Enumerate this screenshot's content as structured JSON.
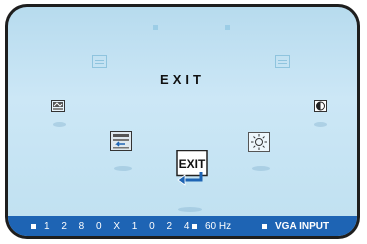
{
  "osd": {
    "menu_title": "EXIT",
    "selected_icon": "exit-icon",
    "icons": [
      "picture-icon-faint",
      "color-icon-faint",
      "image-adjust-icon",
      "contrast-icon",
      "input-select-icon",
      "brightness-icon",
      "exit-icon"
    ]
  },
  "exit_icon_text": "EXIT",
  "status": {
    "resolution": "1 2 8 0 X 1 0 2 4",
    "refresh": "60 Hz",
    "input": "VGA INPUT"
  },
  "colors": {
    "bezel": "#1e1e1e",
    "background": "#c4e3f3",
    "status_bar": "#1e64b4",
    "status_text": "#ffffff",
    "selected_bg": "#1e64b4"
  }
}
